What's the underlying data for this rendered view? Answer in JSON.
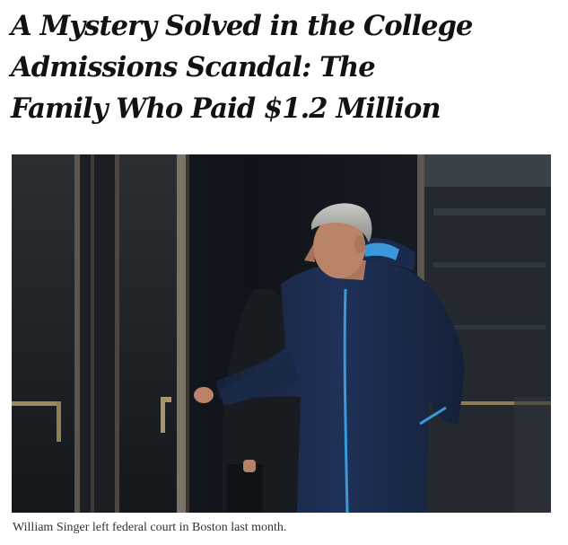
{
  "article": {
    "headline_lines": [
      "A Mystery Solved in the College",
      "Admissions Scandal: The",
      "Family Who Paid $1.2 Million"
    ],
    "photo": {
      "subject": "Man in a navy blue zip jacket with light blue trim walking out of a glass revolving door",
      "colors": {
        "jacket": "#1c2b4a",
        "trim": "#3a9ad9",
        "door_metal": "#7a7468",
        "background": "#15191d"
      }
    },
    "caption": "William Singer left federal court in Boston last month."
  }
}
